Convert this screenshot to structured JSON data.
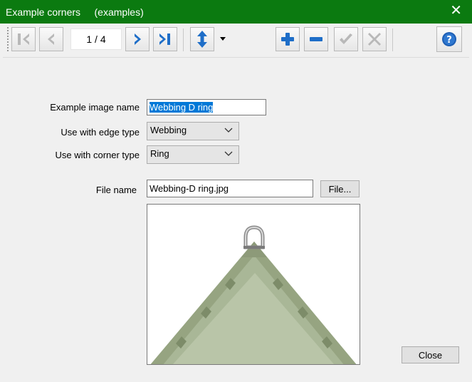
{
  "window": {
    "title": "Example corners     (examples)",
    "close_glyph": "✕",
    "titlebar_color": "#0b7a10"
  },
  "toolbar": {
    "position_text": "1 / 4",
    "buttons": {
      "first": "first-record-icon",
      "prev": "previous-record-icon",
      "next": "next-record-icon",
      "last": "last-record-icon",
      "sort": "sort-updown-icon",
      "add": "add-icon",
      "remove": "remove-icon",
      "accept": "checkmark-icon",
      "cancel": "cancel-icon",
      "help": "help-icon"
    },
    "accent_color": "#1e6ec8"
  },
  "form": {
    "example_image_name_label": "Example image name",
    "example_image_name_value": "Webbing D ring",
    "edge_type_label": "Use with edge type",
    "edge_type_value": "Webbing",
    "corner_type_label": "Use with corner type",
    "corner_type_value": "Ring",
    "file_name_label": "File name",
    "file_name_value": "Webbing-D ring.jpg",
    "file_button": "File...",
    "close_button": "Close",
    "selection_color": "#0078d7"
  }
}
